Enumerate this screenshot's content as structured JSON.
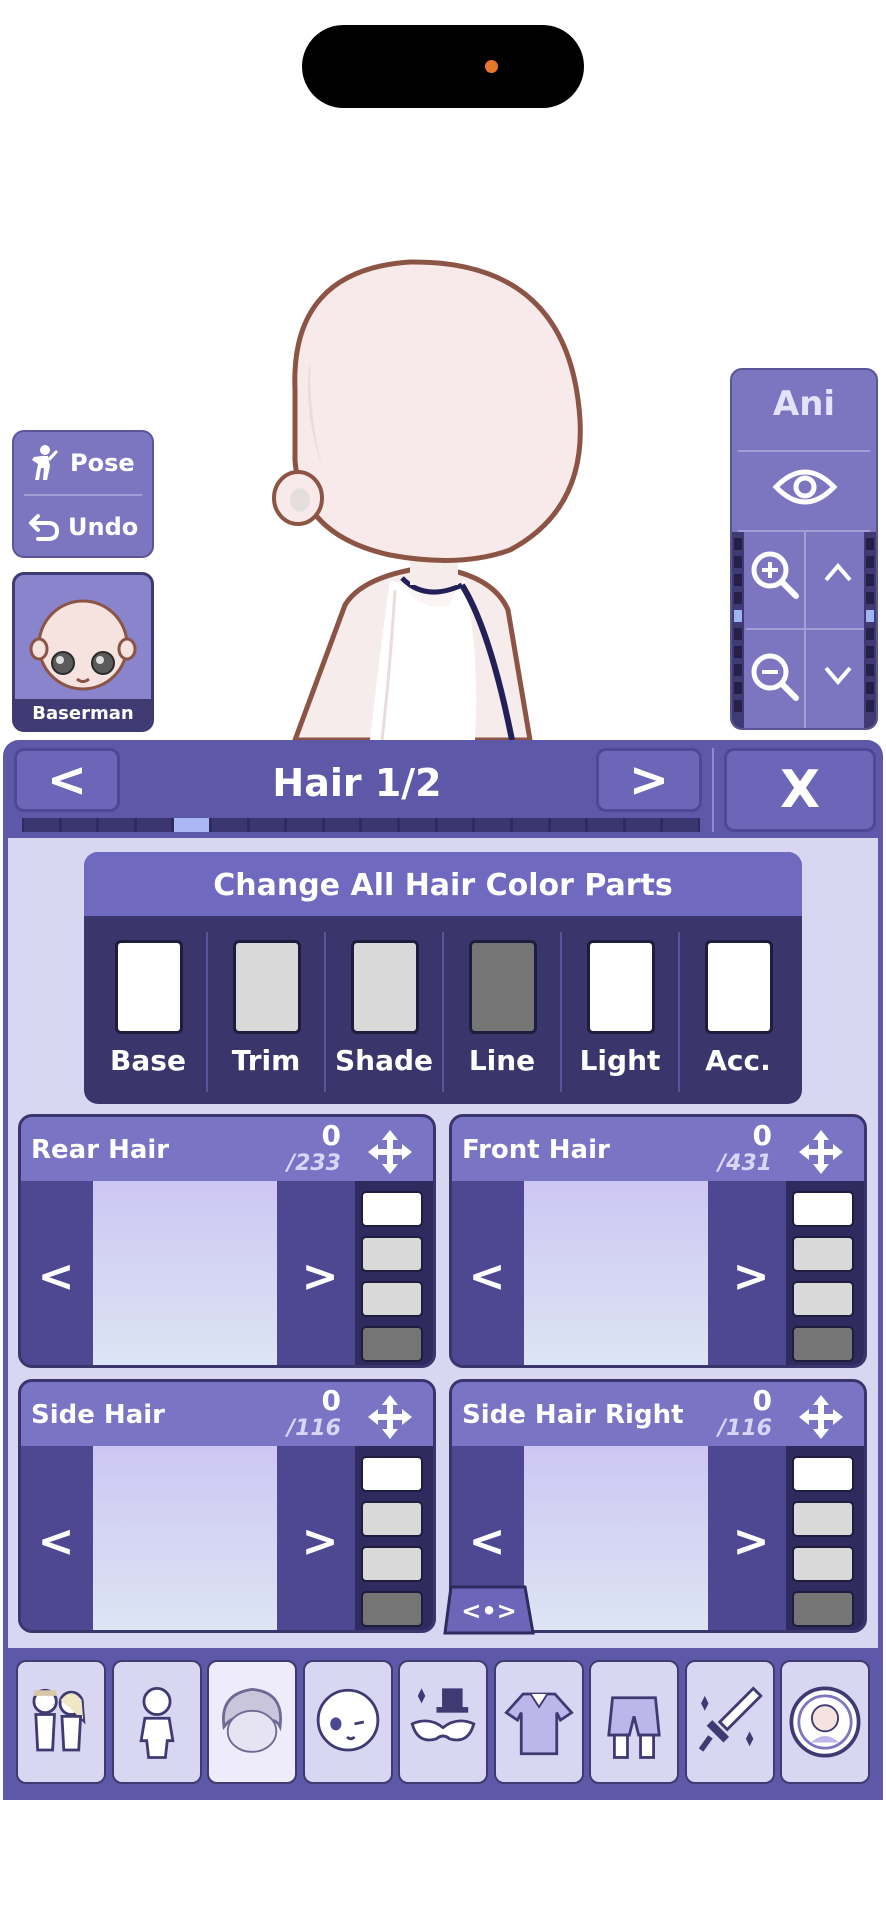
{
  "status_bar": {
    "camera": "camera-dot"
  },
  "left_controls": {
    "pose_label": "Pose",
    "undo_label": "Undo",
    "avatar_name": "Baserman"
  },
  "right_controls": {
    "ani_label": "Ani"
  },
  "editor": {
    "title": "Hair 1/2",
    "prev_label": "<",
    "next_label": ">",
    "close_label": "X",
    "pager": {
      "total": 18,
      "active_index": 4
    }
  },
  "color_parts": {
    "heading": "Change All Hair Color Parts",
    "items": [
      {
        "label": "Base",
        "color": "#ffffff"
      },
      {
        "label": "Trim",
        "color": "#d9d9d9"
      },
      {
        "label": "Shade",
        "color": "#d9d9d9"
      },
      {
        "label": "Line",
        "color": "#757575"
      },
      {
        "label": "Light",
        "color": "#ffffff"
      },
      {
        "label": "Acc.",
        "color": "#ffffff"
      }
    ]
  },
  "hair_parts": [
    {
      "name": "Rear Hair",
      "count": "0",
      "total": "/233",
      "prev": "<",
      "next": ">",
      "swatches": [
        "#ffffff",
        "#d9d9d9",
        "#d9d9d9",
        "#757575"
      ]
    },
    {
      "name": "Front Hair",
      "count": "0",
      "total": "/431",
      "prev": "<",
      "next": ">",
      "swatches": [
        "#ffffff",
        "#d9d9d9",
        "#d9d9d9",
        "#757575"
      ]
    },
    {
      "name": "Side Hair",
      "count": "0",
      "total": "/116",
      "prev": "<",
      "next": ">",
      "swatches": [
        "#ffffff",
        "#d9d9d9",
        "#d9d9d9",
        "#757575"
      ]
    },
    {
      "name": "Side Hair Right",
      "count": "0",
      "total": "/116",
      "prev": "<",
      "next": ">",
      "swatches": [
        "#ffffff",
        "#d9d9d9",
        "#d9d9d9",
        "#757575"
      ]
    }
  ],
  "toggle_label": "<•>",
  "bottom_nav": [
    {
      "name": "presets-tab",
      "icon": "duo-characters-icon"
    },
    {
      "name": "body-tab",
      "icon": "body-icon"
    },
    {
      "name": "hair-tab",
      "icon": "hair-icon",
      "active": true
    },
    {
      "name": "face-tab",
      "icon": "face-icon"
    },
    {
      "name": "accessories-tab",
      "icon": "hat-mask-icon"
    },
    {
      "name": "top-tab",
      "icon": "shirt-icon"
    },
    {
      "name": "bottom-tab",
      "icon": "shorts-icon"
    },
    {
      "name": "weapons-tab",
      "icon": "sword-icon"
    },
    {
      "name": "profile-tab",
      "icon": "profile-badge-icon"
    }
  ]
}
